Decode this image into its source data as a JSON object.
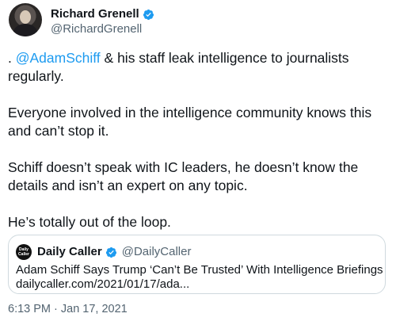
{
  "author": {
    "name": "Richard Grenell",
    "handle": "@RichardGrenell",
    "verified_icon": "verified-badge-icon"
  },
  "tweet": {
    "paragraph1_prefix": ". ",
    "paragraph1_mention": "@AdamSchiff",
    "paragraph1_suffix": " & his staff leak intelligence to journalists regularly.",
    "paragraph2": "Everyone involved in the intelligence community knows this and can’t stop it.",
    "paragraph3": "Schiff doesn’t speak with IC leaders, he doesn’t know the details and isn’t an expert on any topic.",
    "paragraph4": "He’s totally out of the loop."
  },
  "quoted": {
    "avatar_text": "Daily Caller",
    "name": "Daily Caller",
    "handle": "@DailyCaller",
    "headline": "Adam Schiff Says Trump ‘Can’t Be Trusted’ With Intelligence Briefings",
    "link": "dailycaller.com/2021/01/17/ada..."
  },
  "timestamp": "6:13 PM · Jan 17, 2021",
  "colors": {
    "accent": "#1d9bf0",
    "secondary_text": "#536471",
    "border": "#cfd9de"
  }
}
